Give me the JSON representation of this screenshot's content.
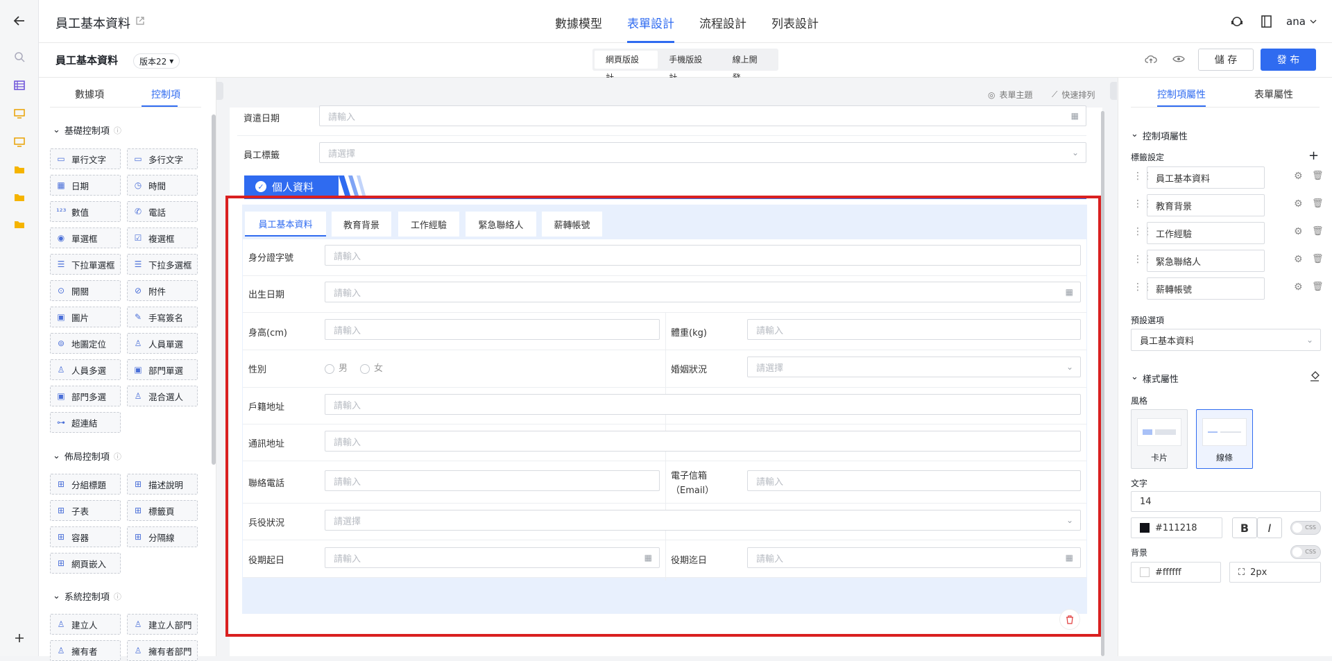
{
  "header": {
    "title": "員工基本資料",
    "nav_tabs": [
      "數據模型",
      "表單設計",
      "流程設計",
      "列表設計"
    ],
    "user": "ana"
  },
  "subbar": {
    "form_name": "員工基本資料",
    "version": "版本22",
    "modes": [
      "網頁版設計",
      "手機版設計",
      "線上開發"
    ],
    "save": "儲 存",
    "publish": "發 布"
  },
  "left_panel": {
    "tabs": [
      "數據項",
      "控制項"
    ],
    "sections": [
      {
        "title": "基礎控制項",
        "items": [
          "單行文字",
          "多行文字",
          "日期",
          "時間",
          "數值",
          "電話",
          "單選框",
          "複選框",
          "下拉單選框",
          "下拉多選框",
          "開關",
          "附件",
          "圖片",
          "手寫簽名",
          "地圖定位",
          "人員單選",
          "人員多選",
          "部門單選",
          "部門多選",
          "混合選人",
          "超連結"
        ]
      },
      {
        "title": "佈局控制項",
        "items": [
          "分組標題",
          "描述說明",
          "子表",
          "標籤頁",
          "容器",
          "分隔線",
          "網頁嵌入"
        ]
      },
      {
        "title": "系統控制項",
        "items": [
          "建立人",
          "建立人部門",
          "擁有者",
          "擁有者部門"
        ]
      }
    ]
  },
  "canvas": {
    "toolbar": [
      "表單主題",
      "快速排列"
    ],
    "pre_fields": [
      {
        "label": "資遣日期",
        "placeholder": "請輸入"
      },
      {
        "label": "員工標籤",
        "placeholder": "請選擇"
      }
    ],
    "group_title": "個人資料",
    "tabs": [
      "員工基本資料",
      "教育背景",
      "工作經驗",
      "緊急聯絡人",
      "薪轉帳號"
    ],
    "fields": {
      "id_number": {
        "label": "身分證字號",
        "placeholder": "請輸入"
      },
      "birth": {
        "label": "出生日期",
        "placeholder": "請輸入"
      },
      "height": {
        "label": "身高(cm)",
        "placeholder": "請輸入"
      },
      "weight": {
        "label": "體重(kg)",
        "placeholder": "請輸入"
      },
      "gender": {
        "label": "性別",
        "options": [
          "男",
          "女"
        ]
      },
      "marital": {
        "label": "婚姻狀況",
        "placeholder": "請選擇"
      },
      "household_addr": {
        "label": "戶籍地址",
        "placeholder": "請輸入"
      },
      "mail_addr": {
        "label": "通訊地址",
        "placeholder": "請輸入"
      },
      "phone": {
        "label": "聯絡電話",
        "placeholder": "請輸入"
      },
      "email_label_1": "電子信箱",
      "email_label_2": "（Email）",
      "email_placeholder": "請輸入",
      "military": {
        "label": "兵役狀況",
        "placeholder": "請選擇"
      },
      "service_start": {
        "label": "役期起日",
        "placeholder": "請輸入"
      },
      "service_end": {
        "label": "役期迄日",
        "placeholder": "請輸入"
      }
    }
  },
  "right_panel": {
    "tabs": [
      "控制項屬性",
      "表單屬性"
    ],
    "section_ctl": "控制項屬性",
    "tag_settings": "標籤設定",
    "tags": [
      "員工基本資料",
      "教育背景",
      "工作經驗",
      "緊急聯絡人",
      "薪轉帳號"
    ],
    "default_label": "預設選項",
    "default_value": "員工基本資料",
    "section_style": "樣式屬性",
    "style_label": "風格",
    "styles": [
      "卡片",
      "線條"
    ],
    "text_label": "文字",
    "font_size": "14",
    "text_color": "#111218",
    "bg_label": "背景",
    "bg_color": "#ffffff",
    "radius": "2px",
    "css": "CSS"
  },
  "colors": {
    "accent": "#2f6bf0",
    "highlight": "#d92020"
  }
}
